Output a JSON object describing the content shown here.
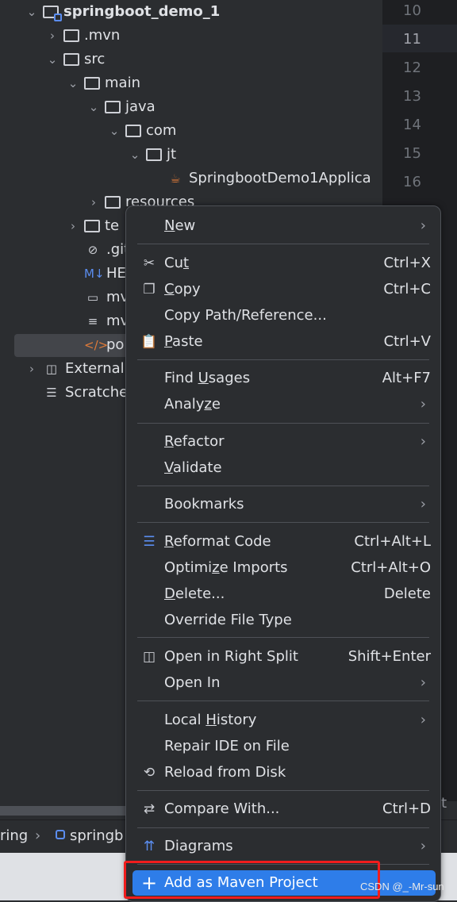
{
  "gutter": {
    "lines": [
      "10",
      "11",
      "12",
      "13",
      "14",
      "15",
      "16"
    ],
    "current": "11"
  },
  "tree": [
    {
      "label": "springboot_demo_1",
      "level": 0,
      "expanded": true,
      "icon": "module-folder-icon",
      "bold": true
    },
    {
      "label": ".mvn",
      "level": 1,
      "expanded": false,
      "icon": "folder-icon"
    },
    {
      "label": "src",
      "level": 1,
      "expanded": true,
      "icon": "folder-icon"
    },
    {
      "label": "main",
      "level": 2,
      "expanded": true,
      "icon": "folder-icon"
    },
    {
      "label": "java",
      "level": 3,
      "expanded": true,
      "icon": "folder-icon"
    },
    {
      "label": "com",
      "level": 4,
      "expanded": true,
      "icon": "folder-icon"
    },
    {
      "label": "jt",
      "level": 5,
      "expanded": true,
      "icon": "folder-icon"
    },
    {
      "label": "SpringbootDemo1Applica",
      "level": 6,
      "icon": "java-class-icon"
    },
    {
      "label": "resources",
      "level": 3,
      "expanded": false,
      "icon": "folder-icon"
    },
    {
      "label": "te",
      "level": 2,
      "expanded": false,
      "icon": "folder-icon"
    },
    {
      "label": ".gitig",
      "level": 2,
      "icon": "ignore-file-icon"
    },
    {
      "label": "HEL",
      "level": 2,
      "icon": "markdown-icon"
    },
    {
      "label": "mvn",
      "level": 2,
      "icon": "terminal-script-icon"
    },
    {
      "label": "mvn",
      "level": 2,
      "icon": "text-file-icon"
    },
    {
      "label": "pom",
      "level": 2,
      "icon": "xml-file-icon",
      "selected": true
    },
    {
      "label": "External Li",
      "level": 0,
      "expanded": false,
      "icon": "library-icon"
    },
    {
      "label": "Scratches",
      "level": 0,
      "icon": "scratches-icon"
    }
  ],
  "status": {
    "crumb1": "ring",
    "crumb2": "springb",
    "right_fragment": "t"
  },
  "menu": {
    "items": [
      {
        "label": "New",
        "mn": "N",
        "arrow": true
      },
      {
        "label": "Cut",
        "mn": "t",
        "icon": "scissors-icon",
        "shortcut": "Ctrl+X",
        "sep": true
      },
      {
        "label": "Copy",
        "mn": "C",
        "icon": "copy-icon",
        "shortcut": "Ctrl+C"
      },
      {
        "label": "Copy Path/Reference..."
      },
      {
        "label": "Paste",
        "mn": "P",
        "icon": "paste-icon",
        "shortcut": "Ctrl+V"
      },
      {
        "label": "Find Usages",
        "mn": "U",
        "shortcut": "Alt+F7",
        "sep": true
      },
      {
        "label": "Analyze",
        "mn": "z",
        "arrow": true
      },
      {
        "label": "Refactor",
        "mn": "R",
        "arrow": true,
        "sep": true
      },
      {
        "label": "Validate",
        "mn": "V"
      },
      {
        "label": "Bookmarks",
        "arrow": true,
        "sep": true
      },
      {
        "label": "Reformat Code",
        "mn": "R",
        "icon": "reformat-icon",
        "shortcut": "Ctrl+Alt+L",
        "sep": true
      },
      {
        "label": "Optimize Imports",
        "mn": "z",
        "shortcut": "Ctrl+Alt+O"
      },
      {
        "label": "Delete...",
        "mn": "D",
        "shortcut": "Delete"
      },
      {
        "label": "Override File Type"
      },
      {
        "label": "Open in Right Split",
        "icon": "split-icon",
        "shortcut": "Shift+Enter",
        "sep": true
      },
      {
        "label": "Open In",
        "arrow": true
      },
      {
        "label": "Local History",
        "mn": "H",
        "arrow": true,
        "sep": true
      },
      {
        "label": "Repair IDE on File"
      },
      {
        "label": "Reload from Disk",
        "icon": "reload-icon"
      },
      {
        "label": "Compare With...",
        "icon": "compare-icon",
        "shortcut": "Ctrl+D",
        "sep": true
      },
      {
        "label": "Diagrams",
        "icon": "diagrams-icon",
        "arrow": true,
        "sep": true
      },
      {
        "label": "Add as Maven Project",
        "icon": "plus-icon",
        "highlighted": true,
        "sep": true
      }
    ]
  },
  "watermark": "CSDN @_-Mr-sun",
  "colors": {
    "accent": "#2e7de9",
    "highlight_box": "#f01d1d",
    "background": "#2b2d30"
  }
}
